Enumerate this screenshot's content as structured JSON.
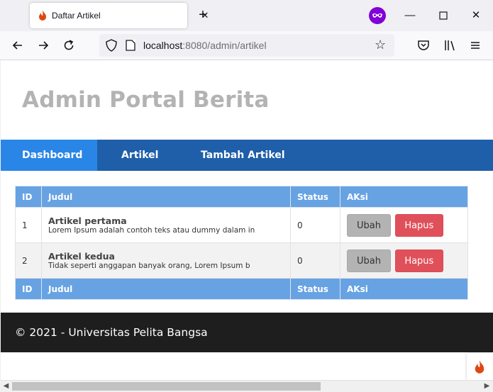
{
  "browser": {
    "tab_title": "Daftar Artikel",
    "url_host": "localhost",
    "url_rest": ":8080/admin/artikel",
    "accent_privacy": "#8000d7"
  },
  "header": {
    "title": "Admin Portal Berita"
  },
  "menu": {
    "items": [
      {
        "label": "Dashboard"
      },
      {
        "label": "Artikel"
      },
      {
        "label": "Tambah Artikel"
      }
    ]
  },
  "table": {
    "columns": [
      "ID",
      "Judul",
      "Status",
      "AKsi"
    ],
    "rows": [
      {
        "id": "1",
        "title": "Artikel pertama",
        "desc": "Lorem Ipsum adalah contoh teks atau dummy dalam in",
        "status": "0",
        "edit": "Ubah",
        "delete": "Hapus"
      },
      {
        "id": "2",
        "title": "Artikel kedua",
        "desc": "Tidak seperti anggapan banyak orang, Lorem Ipsum b",
        "status": "0",
        "edit": "Ubah",
        "delete": "Hapus"
      }
    ]
  },
  "footer": {
    "text": "© 2021 - Universitas Pelita Bangsa"
  },
  "colors": {
    "menu_bg": "#1f5faa",
    "menu_active": "#2a86e6",
    "table_header": "#67a2e3",
    "delete_button": "#e0505a",
    "edit_button": "#b3b3b3",
    "footer_bg": "#1e1e1e"
  },
  "icons": [
    "flame-icon",
    "close-icon",
    "plus-icon",
    "privacy-mask-icon",
    "minimize-icon",
    "maximize-icon",
    "window-close-icon",
    "back-arrow-icon",
    "forward-arrow-icon",
    "reload-icon",
    "shield-icon",
    "page-icon",
    "star-icon",
    "pocket-icon",
    "library-icon",
    "menu-icon"
  ]
}
